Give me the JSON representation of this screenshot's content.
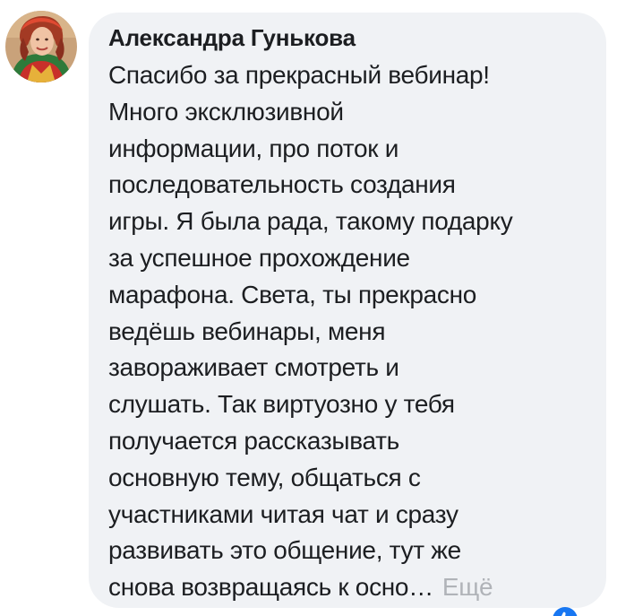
{
  "comment": {
    "author": "Александра Гунькова",
    "lines": [
      "Спасибо за прекрасный вебинар!",
      "Много эксклюзивной",
      "информации, про поток и",
      "последовательность создания",
      "игры. Я была рада, такому подарку",
      "за успешное прохождение",
      "марафона. Света, ты прекрасно",
      "ведёшь вебинары, меня",
      "завораживает смотреть и",
      "слушать. Так виртуозно у тебя",
      "получается рассказывать",
      "основную тему, общаться с",
      "участниками читая чат и сразу",
      "развивать это общение, тут же",
      "снова возвращаясь к осно…"
    ],
    "more_label": "Ещё"
  },
  "icons": {
    "avatar": "avatar-photo",
    "reaction": "like-reaction-icon"
  },
  "colors": {
    "bubble_bg": "#f0f2f5",
    "text": "#1c1e21",
    "more": "#b0b3b8",
    "reaction": "#1877f2"
  }
}
